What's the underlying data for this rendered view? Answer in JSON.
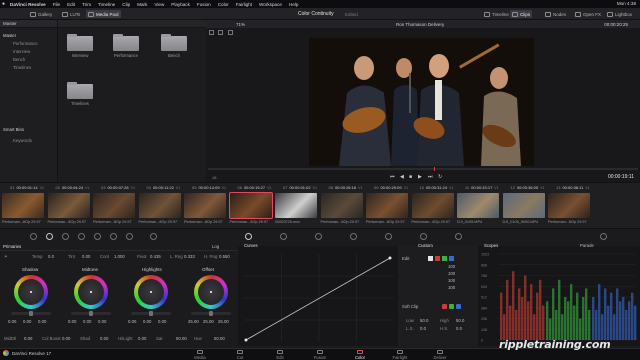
{
  "menubar": {
    "apple": "",
    "app_name": "DaVinci Resolve",
    "items": [
      "File",
      "Edit",
      "Trim",
      "Timeline",
      "Clip",
      "Mark",
      "View",
      "Playback",
      "Fusion",
      "Color",
      "Fairlight",
      "Workspace",
      "Help"
    ],
    "clock": "Mon 4:38"
  },
  "toolbar": {
    "gallery": "Gallery",
    "luts": "LUTs",
    "media_pool": "Media Pool",
    "zoom": "71%",
    "page_title": "Color Continuity",
    "edited": "Edited",
    "timeline_name": "Ron Thomason Delivery",
    "timeline_btn": "Timeline",
    "clips_btn": "Clips",
    "nodes": "Nodes",
    "openfx": "Open FX",
    "lightbox": "Lightbox"
  },
  "media_pool": {
    "header": "Master",
    "master": "Master",
    "bins": [
      "Performance",
      "Interview",
      "Bench",
      "Timelines"
    ],
    "smart_bins_header": "Smart Bins",
    "smart_bins": [
      "Keywords"
    ],
    "folders": [
      "Interview",
      "Performance",
      "Bench",
      "Timelines"
    ]
  },
  "viewer": {
    "timecode_top": "00:00:20:25",
    "playhead_timecode": "00:00:19:11",
    "frame_label": "18"
  },
  "thumbnails": [
    {
      "num": "01",
      "tc": "00:00:01:14",
      "track": "V1",
      "label": "Performan...8Op 29.97"
    },
    {
      "num": "02",
      "tc": "00:00:04:24",
      "track": "V1",
      "label": "Performan...8Op 29.97"
    },
    {
      "num": "03",
      "tc": "00:00:07:28",
      "track": "V1",
      "label": "Performan...8Op 29.97"
    },
    {
      "num": "04",
      "tc": "00:00:11:22",
      "track": "V1",
      "label": "Performan...8Op 29.97"
    },
    {
      "num": "05",
      "tc": "00:00:14:09",
      "track": "V1",
      "label": "Performan...8Op 29.97"
    },
    {
      "num": "06",
      "tc": "00:00:19:27",
      "track": "V1",
      "label": "Performan...8Op 29.97"
    },
    {
      "num": "07",
      "tc": "00:00:01:02",
      "track": "V1",
      "label": "00003725.mov"
    },
    {
      "num": "08",
      "tc": "00:00:26:16",
      "track": "V1",
      "label": "Performan...8Op 29.97"
    },
    {
      "num": "09",
      "tc": "00:00:29:09",
      "track": "V1",
      "label": "Performan...8Op 29.97"
    },
    {
      "num": "10",
      "tc": "00:00:31:24",
      "track": "V1",
      "label": "Performan...8Op 29.97"
    },
    {
      "num": "11",
      "tc": "00:00:33:17",
      "track": "V1",
      "label": "DJI_0105.MP4"
    },
    {
      "num": "12",
      "tc": "00:00:36:05",
      "track": "V1",
      "label": "DJI_0105_5000.MP4"
    },
    {
      "num": "13",
      "tc": "00:00:38:11",
      "track": "V1",
      "label": "Performan...8Op 29.97"
    }
  ],
  "primaries": {
    "title": "Primaries",
    "mode": "Log",
    "temp_label": "Temp",
    "temp_value": "0.0",
    "tint_label": "Tint",
    "tint_value": "0.00",
    "contrast_label": "Cont",
    "contrast_value": "1.000",
    "pivot_label": "Pivot",
    "pivot_value": "0.435",
    "lrange_label": "L. Rng",
    "lrange_value": "0.333",
    "hrange_label": "H. Rng",
    "hrange_value": "0.550",
    "wheels": [
      {
        "name": "Shadow",
        "values": [
          "0.00",
          "0.00",
          "0.00"
        ]
      },
      {
        "name": "Midtone",
        "values": [
          "0.00",
          "0.00",
          "0.00"
        ]
      },
      {
        "name": "Highlights",
        "values": [
          "0.00",
          "0.00",
          "0.00"
        ]
      },
      {
        "name": "Offset",
        "values": [
          "25.00",
          "25.00",
          "25.00"
        ]
      }
    ],
    "bottom": [
      {
        "label": "MidDtl",
        "value": "0.00"
      },
      {
        "label": "Col Boost",
        "value": "0.00"
      },
      {
        "label": "Shad",
        "value": "0.00"
      },
      {
        "label": "Hi/Light",
        "value": "0.00"
      },
      {
        "label": "Sat",
        "value": "50.00"
      },
      {
        "label": "Hue",
        "value": "50.00"
      }
    ]
  },
  "curves": {
    "title": "Curves"
  },
  "custom": {
    "title": "Custom",
    "edit": "Edit",
    "channels": [
      "100",
      "100",
      "100",
      "100"
    ],
    "soft_clip": "Soft Clip",
    "low": "Low",
    "low_value": "50.0",
    "high": "High",
    "high_value": "50.0",
    "ls": "L.S.",
    "ls_value": "0.0",
    "hs": "H.S.",
    "hs_value": "0.0"
  },
  "scopes": {
    "title": "Scopes",
    "mode": "Parade",
    "ticks": [
      "1023",
      "896",
      "768",
      "640",
      "512",
      "384",
      "256",
      "128",
      "0"
    ]
  },
  "pagebar": {
    "app": "DaVinci Resolve 17",
    "tabs": [
      "Media",
      "Cut",
      "Edit",
      "Fusion",
      "Color",
      "Fairlight",
      "Deliver"
    ],
    "active": "Color"
  },
  "watermark": "rippletraining.com"
}
